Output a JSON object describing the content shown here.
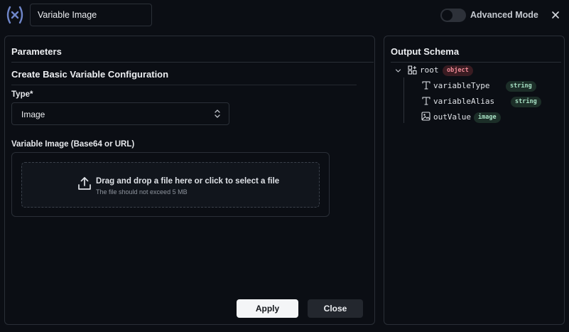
{
  "header": {
    "name_value": "Variable Image",
    "advanced_mode_label": "Advanced Mode",
    "advanced_mode_on": false
  },
  "parameters": {
    "title": "Parameters",
    "section_title": "Create Basic Variable Configuration",
    "type_label": "Type*",
    "type_value": "Image",
    "image_label": "Variable Image (Base64 or URL)",
    "drop_text": "Drag and drop a file here or click to select a file",
    "drop_hint": "The file should not exceed 5 MB"
  },
  "buttons": {
    "apply": "Apply",
    "close": "Close"
  },
  "schema": {
    "title": "Output Schema",
    "root": {
      "name": "root",
      "type": "object"
    },
    "fields": [
      {
        "name": "variableType",
        "type": "string",
        "icon": "text-type-icon"
      },
      {
        "name": "variableAlias",
        "type": "string",
        "icon": "text-type-icon"
      },
      {
        "name": "outValue",
        "type": "image",
        "icon": "image-type-icon"
      }
    ]
  },
  "colors": {
    "background": "#0b0e14",
    "logo_accent": "#6f86c9",
    "object_badge": "#f08a96",
    "string_badge": "#a7e0c4"
  }
}
